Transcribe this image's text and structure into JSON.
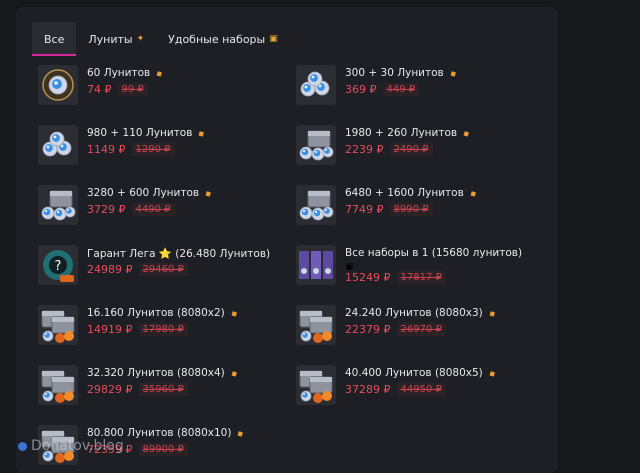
{
  "tabs": [
    {
      "label": "Все",
      "icon": "",
      "active": true
    },
    {
      "label": "Луниты",
      "icon": "✦",
      "active": false
    },
    {
      "label": "Удобные наборы",
      "icon": "▣",
      "active": false
    }
  ],
  "items": [
    {
      "name": "60 Лунитов",
      "badge": "gem",
      "price": "74 ₽",
      "old_price": "99 ₽",
      "thumb": "single-crystal-icon"
    },
    {
      "name": "300 + 30 Лунитов",
      "badge": "gem",
      "price": "369 ₽",
      "old_price": "449 ₽",
      "thumb": "crystal-pile-icon"
    },
    {
      "name": "980 + 110 Лунитов",
      "badge": "gem",
      "price": "1149 ₽",
      "old_price": "1290 ₽",
      "thumb": "crystal-pile-icon"
    },
    {
      "name": "1980 + 260 Лунитов",
      "badge": "gem",
      "price": "2239 ₽",
      "old_price": "2490 ₽",
      "thumb": "crystal-chest-icon"
    },
    {
      "name": "3280 + 600 Лунитов",
      "badge": "gem",
      "price": "3729 ₽",
      "old_price": "4490 ₽",
      "thumb": "crystal-chest-icon"
    },
    {
      "name": "6480 + 1600 Лунитов",
      "badge": "gem",
      "price": "7749 ₽",
      "old_price": "8990 ₽",
      "thumb": "crystal-chest-icon"
    },
    {
      "name": "Гарант Лега ⭐ (26.480 Лунитов)",
      "badge": "",
      "price": "24989 ₽",
      "old_price": "29460 ₽",
      "thumb": "mystery-hero-icon"
    },
    {
      "name": "Все наборы в 1 (15680 лунитов)",
      "badge": "box-below",
      "price": "15249 ₽",
      "old_price": "17817 ₽",
      "thumb": "card-bundle-icon"
    },
    {
      "name": "16.160 Лунитов (8080x2)",
      "badge": "gem",
      "price": "14919 ₽",
      "old_price": "17980 ₽",
      "thumb": "chest-multi-icon"
    },
    {
      "name": "24.240 Лунитов (8080x3)",
      "badge": "gem",
      "price": "22379 ₽",
      "old_price": "26970 ₽",
      "thumb": "chest-multi-icon"
    },
    {
      "name": "32.320 Лунитов (8080x4)",
      "badge": "gem",
      "price": "29829 ₽",
      "old_price": "35960 ₽",
      "thumb": "chest-multi-icon"
    },
    {
      "name": "40.400 Лунитов (8080x5)",
      "badge": "gem",
      "price": "37289 ₽",
      "old_price": "44950 ₽",
      "thumb": "chest-multi-icon"
    },
    {
      "name": "80.800 Лунитов (8080x10)",
      "badge": "gem",
      "price": "72359 ₽",
      "old_price": "89900 ₽",
      "thumb": "chest-multi-icon"
    }
  ],
  "watermark": "Donatov.blog",
  "colors": {
    "accent": "#d8289b",
    "price": "#e34c5b",
    "badge": "#e79b2f",
    "background": "#17181c",
    "panel": "#1e1f24"
  }
}
